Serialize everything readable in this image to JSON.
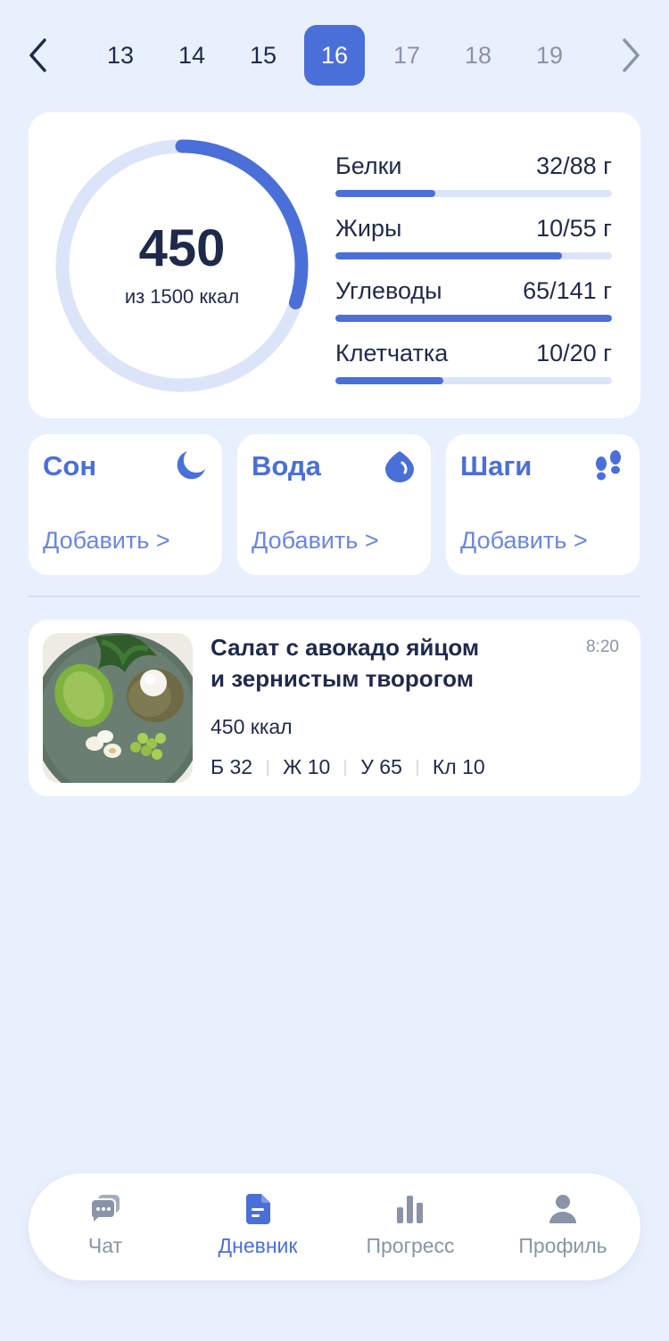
{
  "date_strip": {
    "days": [
      {
        "label": "13",
        "state": "past"
      },
      {
        "label": "14",
        "state": "past"
      },
      {
        "label": "15",
        "state": "past"
      },
      {
        "label": "16",
        "state": "active"
      },
      {
        "label": "17",
        "state": "future"
      },
      {
        "label": "18",
        "state": "future"
      },
      {
        "label": "19",
        "state": "future"
      }
    ]
  },
  "calories": {
    "value": "450",
    "subtitle": "из 1500 ккал",
    "progress": 0.3
  },
  "macros": [
    {
      "label": "Белки",
      "value": "32/88 г",
      "progress": 0.36
    },
    {
      "label": "Жиры",
      "value": "10/55 г",
      "progress": 0.82
    },
    {
      "label": "Углеводы",
      "value": "65/141 г",
      "progress": 1.0
    },
    {
      "label": "Клетчатка",
      "value": "10/20 г",
      "progress": 0.39
    }
  ],
  "trackers": [
    {
      "title": "Сон",
      "action": "Добавить >",
      "icon": "moon-icon"
    },
    {
      "title": "Вода",
      "action": "Добавить >",
      "icon": "water-drop-icon"
    },
    {
      "title": "Шаги",
      "action": "Добавить >",
      "icon": "footprints-icon"
    }
  ],
  "meal": {
    "title_line1": "Салат с авокадо яйцом",
    "title_line2": "и зернистым творогом",
    "time": "8:20",
    "kcal": "450 ккал",
    "macros": [
      "Б 32",
      "Ж 10",
      "У 65",
      "Кл 10"
    ]
  },
  "bottom_nav": [
    {
      "label": "Чат",
      "icon": "chat-icon",
      "active": false
    },
    {
      "label": "Дневник",
      "icon": "diary-icon",
      "active": true
    },
    {
      "label": "Прогресс",
      "icon": "progress-chart-icon",
      "active": false
    },
    {
      "label": "Профиль",
      "icon": "profile-icon",
      "active": false
    }
  ],
  "colors": {
    "accent": "#4A6FD8",
    "background": "#E9F0FD",
    "track": "#DCE4F9",
    "text": "#1F2A4B",
    "muted": "#8A93A8"
  }
}
